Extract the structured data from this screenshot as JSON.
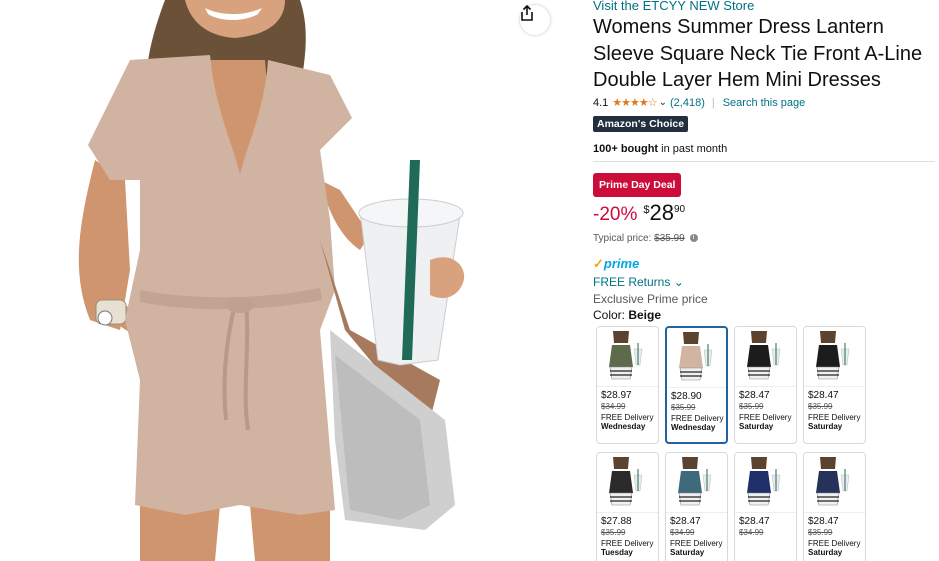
{
  "store_link": "Visit the ETCYY NEW Store",
  "title": "Womens Summer Dress Lantern Sleeve Square Neck Tie Front A-Line Double Layer Hem Mini Dresses",
  "rating": {
    "value": "4.1",
    "stars": "★★★★☆",
    "review_count": "(2,418)",
    "separator": "|",
    "search_link": "Search this page"
  },
  "badge_choice": "Amazon's Choice",
  "bought": {
    "bold": "100+ bought",
    "rest": " in past month"
  },
  "deal_badge": "Prime Day Deal",
  "price": {
    "discount": "-20%",
    "currency": "$",
    "whole": "28",
    "fraction": "90"
  },
  "typical": {
    "label": "Typical price: ",
    "value": "$35.99"
  },
  "prime": {
    "check": "✓",
    "word": "prime"
  },
  "free_returns": "FREE Returns",
  "exclusive": "Exclusive Prime price",
  "color": {
    "label": "Color: ",
    "value": "Beige"
  },
  "swatches": [
    {
      "price": "$28.97",
      "old": "$34.99",
      "delivery": "FREE Delivery",
      "day": "Wednesday",
      "dress_color": "#5d6b4a"
    },
    {
      "price": "$28.90",
      "old": "$35.99",
      "delivery": "FREE Delivery",
      "day": "Wednesday",
      "dress_color": "#d2b4a2"
    },
    {
      "price": "$28.47",
      "old": "$35.99",
      "delivery": "FREE Delivery",
      "day": "Saturday",
      "dress_color": "#1c1c1c"
    },
    {
      "price": "$28.47",
      "old": "$35.99",
      "delivery": "FREE Delivery",
      "day": "Saturday",
      "dress_color": "#1c1c1c"
    },
    {
      "price": "$27.88",
      "old": "$35.99",
      "delivery": "FREE Delivery",
      "day": "Tuesday",
      "dress_color": "#2a2a2a"
    },
    {
      "price": "$28.47",
      "old": "$34.99",
      "delivery": "FREE Delivery",
      "day": "Saturday",
      "dress_color": "#3f6a7c"
    },
    {
      "price": "$28.47",
      "old": "$34.99",
      "delivery": "",
      "day": "",
      "dress_color": "#1f2f6a"
    },
    {
      "price": "$28.47",
      "old": "$35.99",
      "delivery": "FREE Delivery",
      "day": "Saturday",
      "dress_color": "#27325a"
    }
  ],
  "colors": {
    "link": "#007185",
    "deal": "#cc0c39",
    "choice": "#232f3e",
    "selected_border": "#2162a1",
    "dress": "#d1b3a2"
  }
}
